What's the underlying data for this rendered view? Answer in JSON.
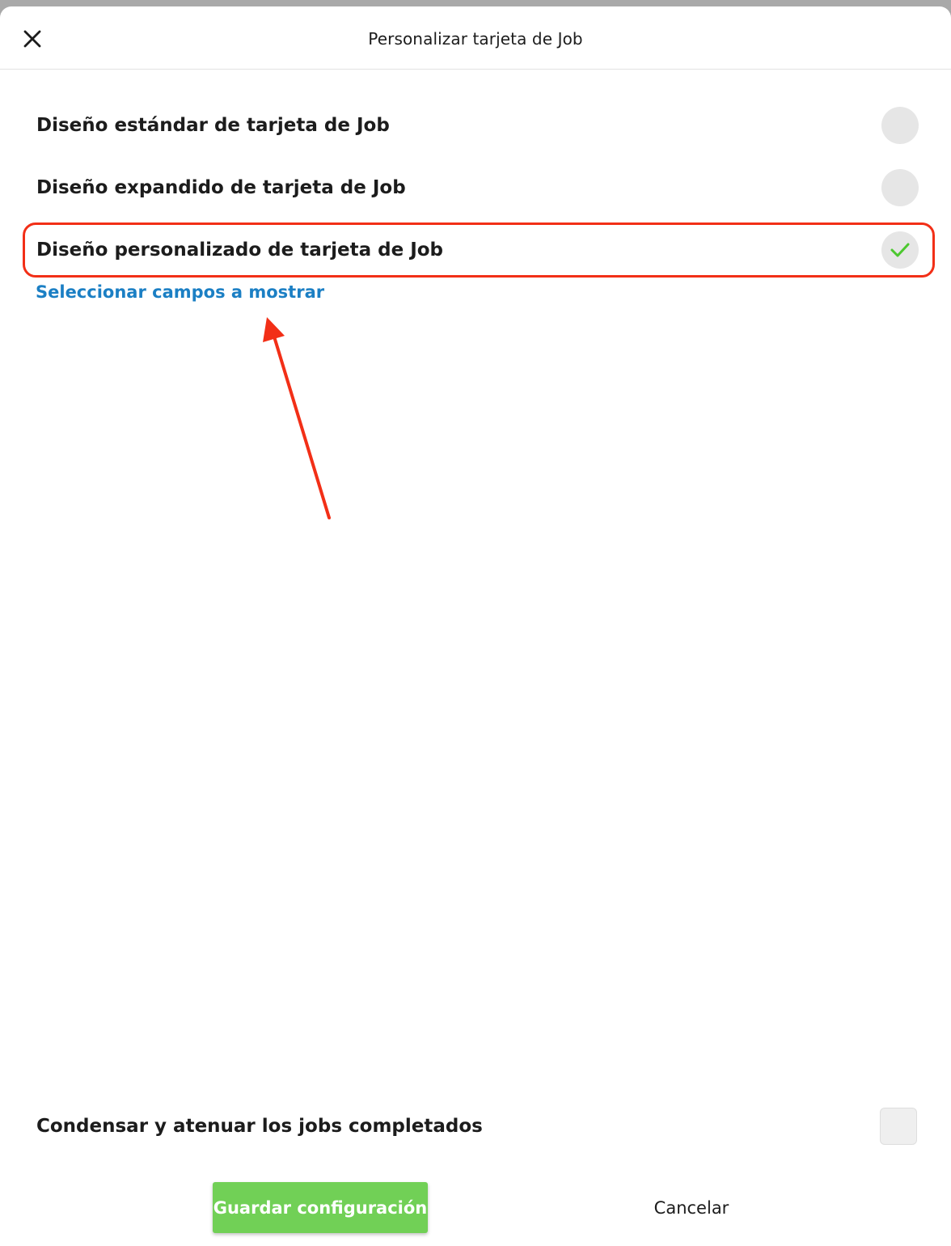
{
  "header": {
    "title": "Personalizar tarjeta de Job",
    "close_icon": "close-icon"
  },
  "layout_options": [
    {
      "label": "Diseño estándar de tarjeta de Job",
      "selected": false
    },
    {
      "label": "Diseño expandido de tarjeta de Job",
      "selected": false
    },
    {
      "label": "Diseño personalizado de tarjeta de Job",
      "selected": true
    }
  ],
  "select_fields_link": "Seleccionar campos a mostrar",
  "condense_option": {
    "label": "Condensar y atenuar los jobs completados",
    "checked": false
  },
  "footer": {
    "save_label": "Guardar configuración",
    "cancel_label": "Cancelar"
  },
  "colors": {
    "accent_green": "#71d056",
    "link_blue": "#1b7fc4",
    "annotation_red": "#f22f17",
    "check_green": "#4cc82f"
  }
}
